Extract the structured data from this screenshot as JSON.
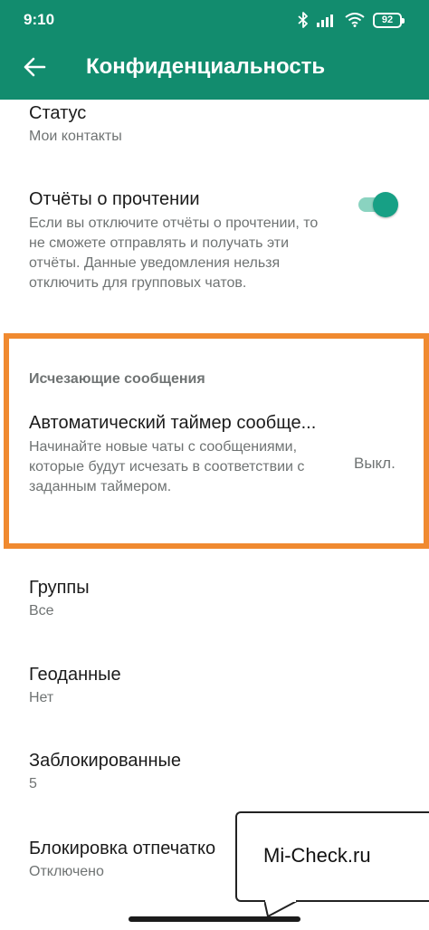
{
  "status_bar": {
    "time": "9:10",
    "battery": "92",
    "icons": [
      "bluetooth-icon",
      "signal-icon",
      "wifi-icon",
      "battery-icon"
    ]
  },
  "app_bar": {
    "title": "Конфиденциальность",
    "back_icon": "arrow-back-icon",
    "color": "#128c6e"
  },
  "items": {
    "status": {
      "title": "Статус",
      "value": "Мои контакты"
    },
    "read_receipts": {
      "title": "Отчёты о прочтении",
      "description": "Если вы отключите отчёты о прочтении, то не сможете отправлять и получать эти отчёты. Данные уведомления нельзя отключить для групповых чатов.",
      "enabled": true
    },
    "disappearing": {
      "section_header": "Исчезающие сообщения",
      "title": "Автоматический таймер сообще...",
      "description": "Начинайте новые чаты с сообщениями, которые будут исчезать в соответствии с заданным таймером.",
      "value": "Выкл."
    },
    "groups": {
      "title": "Группы",
      "value": "Все"
    },
    "location": {
      "title": "Геоданные",
      "value": "Нет"
    },
    "blocked": {
      "title": "Заблокированные",
      "value": "5"
    },
    "fingerprint": {
      "title": "Блокировка отпечатко",
      "value": "Отключено"
    }
  },
  "watermark": {
    "text": "Mi-Check.ru"
  },
  "colors": {
    "accent": "#128c6e",
    "toggle_on": "#17a085",
    "highlight": "#f08a30"
  }
}
